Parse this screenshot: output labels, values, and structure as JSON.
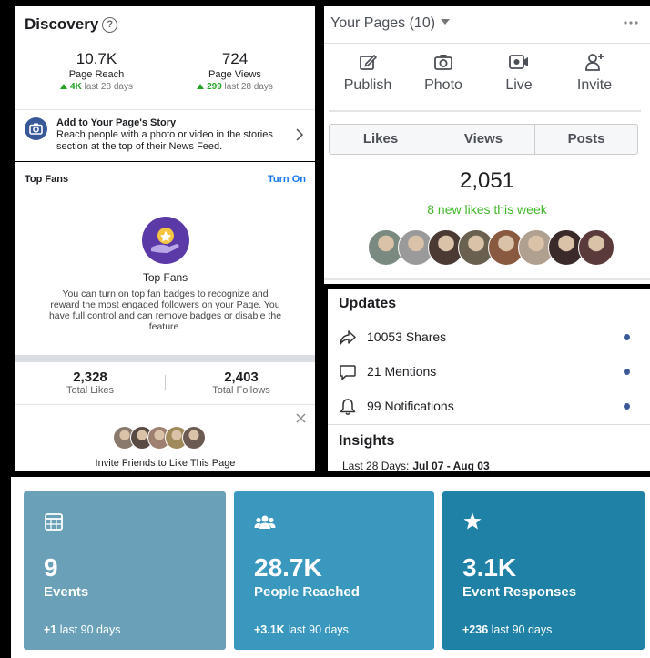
{
  "discovery": {
    "title": "Discovery",
    "help_glyph": "?",
    "page_reach": {
      "value": "10.7K",
      "label": "Page Reach",
      "delta": "4K",
      "period": "last 28 days"
    },
    "page_views": {
      "value": "724",
      "label": "Page Views",
      "delta": "299",
      "period": "last 28 days"
    },
    "story": {
      "title": "Add to Your Page's Story",
      "text": "Reach people with a photo or video in the stories section at the top of their News Feed."
    }
  },
  "top_fans": {
    "header": "Top Fans",
    "action": "Turn On",
    "title": "Top Fans",
    "description": "You can turn on top fan badges to recognize and reward the most engaged followers on your Page. You have full control and can remove badges or disable the feature.",
    "total_likes": {
      "value": "2,328",
      "label": "Total Likes"
    },
    "total_follows": {
      "value": "2,403",
      "label": "Total Follows"
    },
    "invite_text": "Invite Friends to Like This Page",
    "avatar_colors": [
      "#8a7a6e",
      "#5a4a44",
      "#9e8070",
      "#a08a5c",
      "#6b5a52"
    ]
  },
  "your_pages": {
    "title": "Your Pages (10)",
    "actions": [
      {
        "label": "Publish",
        "icon": "pencil-icon"
      },
      {
        "label": "Photo",
        "icon": "camera-icon"
      },
      {
        "label": "Live",
        "icon": "video-icon"
      },
      {
        "label": "Invite",
        "icon": "add-person-icon"
      }
    ],
    "tabs": [
      "Likes",
      "Views",
      "Posts"
    ],
    "likes_count": "2,051",
    "new_likes": "8 new likes this week",
    "avatar_colors": [
      "#7a8a80",
      "#9a9a9a",
      "#4a3a33",
      "#6a6050",
      "#8a5a40",
      "#b0a090",
      "#3a2a2a",
      "#5a3a3a"
    ]
  },
  "updates": {
    "title": "Updates",
    "items": [
      {
        "label": "10053 Shares",
        "icon": "share-icon"
      },
      {
        "label": "21 Mentions",
        "icon": "comment-icon"
      },
      {
        "label": "99 Notifications",
        "icon": "bell-icon"
      }
    ],
    "dot_color": "#3b5998"
  },
  "insights": {
    "title": "Insights",
    "period_label": "Last 28 Days:",
    "period": "Jul 07 - Aug 03"
  },
  "cards": [
    {
      "value": "9",
      "name": "Events",
      "delta": "+1",
      "period": "last 90 days",
      "color": "#6aa1b8",
      "icon": "calendar-icon"
    },
    {
      "value": "28.7K",
      "name": "People Reached",
      "delta": "+3.1K",
      "period": "last 90 days",
      "color": "#3a98bf",
      "icon": "people-icon"
    },
    {
      "value": "3.1K",
      "name": "Event Responses",
      "delta": "+236",
      "period": "last 90 days",
      "color": "#1f81a6",
      "icon": "star-icon"
    }
  ],
  "colors": {
    "green": "#27a327",
    "link_blue": "#1877f2",
    "facebook_blue": "#385898"
  }
}
